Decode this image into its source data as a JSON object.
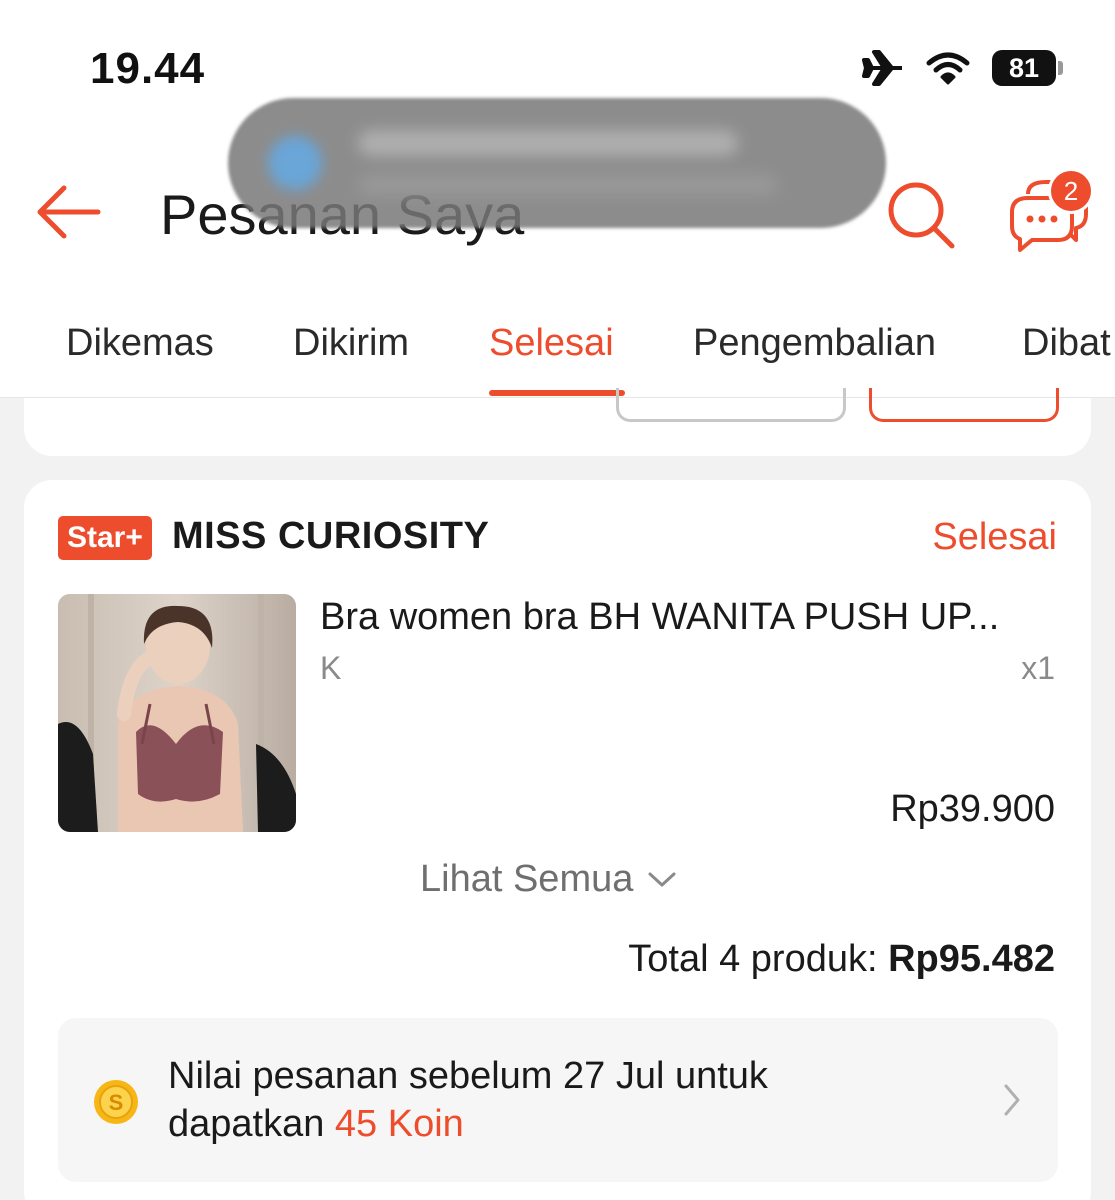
{
  "status_bar": {
    "time": "19.44",
    "battery": "81"
  },
  "header": {
    "title": "Pesanan Saya",
    "chat_badge": "2"
  },
  "tabs": [
    {
      "label": "Dikemas"
    },
    {
      "label": "Dikirim"
    },
    {
      "label": "Selesai",
      "active": true
    },
    {
      "label": "Pengembalian"
    },
    {
      "label": "Dibat"
    }
  ],
  "order": {
    "badge": "Star+",
    "shop_name": "MISS CURIOSITY",
    "status": "Selesai",
    "product": {
      "name": "Bra women bra BH WANITA PUSH UP...",
      "variant": "K",
      "quantity": "x1",
      "price": "Rp39.900"
    },
    "see_all_label": "Lihat Semua",
    "total_label": "Total 4 produk:",
    "total_value": "Rp95.482",
    "coins": {
      "line1": "Nilai pesanan sebelum 27 Jul untuk",
      "line2_prefix": "dapatkan ",
      "amount": "45 Koin"
    }
  },
  "colors": {
    "accent": "#ee4d2d",
    "background": "#f2f2f2"
  }
}
